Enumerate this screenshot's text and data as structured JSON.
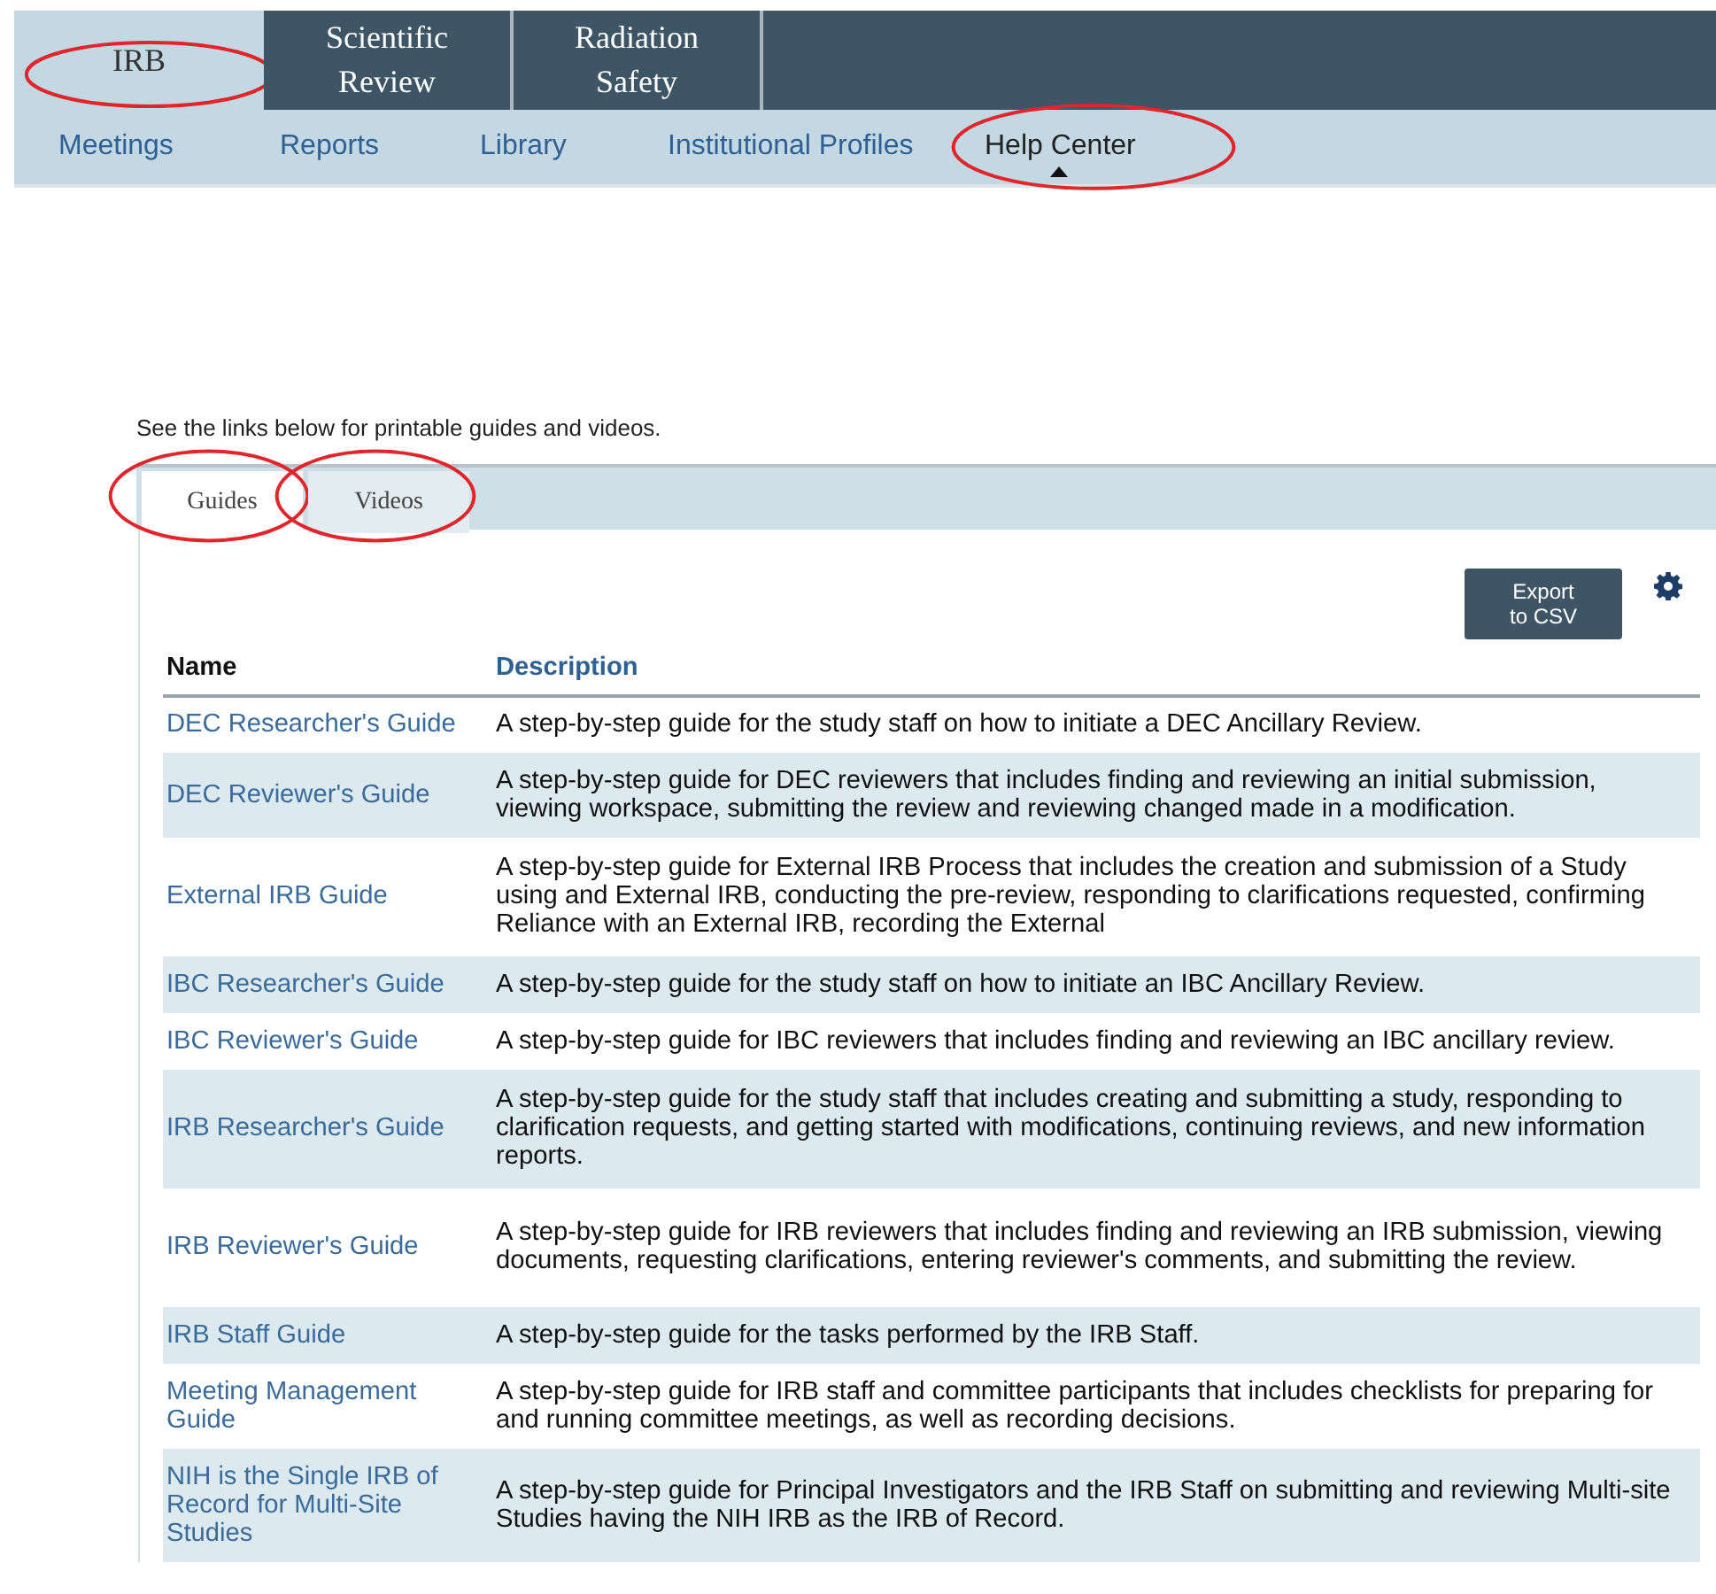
{
  "top_tabs": [
    {
      "label": "IRB",
      "selected": true,
      "circled": true
    },
    {
      "label": "Scientific Review",
      "selected": false,
      "circled": false
    },
    {
      "label": "Radiation Safety",
      "selected": false,
      "circled": false
    }
  ],
  "sub_nav": [
    {
      "label": "Meetings",
      "selected": false,
      "circled": false
    },
    {
      "label": "Reports",
      "selected": false,
      "circled": false
    },
    {
      "label": "Library",
      "selected": false,
      "circled": false
    },
    {
      "label": "Institutional Profiles",
      "selected": false,
      "circled": false
    },
    {
      "label": "Help Center",
      "selected": true,
      "circled": true
    }
  ],
  "intro": "See the links below for printable guides and videos.",
  "content_tabs": [
    {
      "label": "Guides",
      "selected": true,
      "circled": true
    },
    {
      "label": "Videos",
      "selected": false,
      "circled": true
    }
  ],
  "export_button": "Export to CSV",
  "table": {
    "columns": [
      "Name",
      "Description"
    ],
    "rows": [
      {
        "name": "DEC Researcher's Guide",
        "description": "A step-by-step guide for the study staff on how to initiate a DEC Ancillary Review."
      },
      {
        "name": "DEC Reviewer's Guide",
        "description": "A step-by-step guide for DEC reviewers that includes finding and reviewing an initial submission, viewing workspace, submitting the review and reviewing changed made in a modification."
      },
      {
        "name": "External IRB Guide",
        "description": "A step-by-step guide for External IRB Process that includes the creation and submission of a Study using and External IRB, conducting the pre-review, responding to clarifications requested, confirming Reliance with an External IRB, recording the External"
      },
      {
        "name": "IBC Researcher's Guide",
        "description": "A step-by-step guide for the study staff on how to initiate an IBC Ancillary Review."
      },
      {
        "name": "IBC Reviewer's Guide",
        "description": "A step-by-step guide for IBC reviewers that includes finding and reviewing an IBC ancillary review."
      },
      {
        "name": "IRB Researcher's Guide",
        "description": "A step-by-step guide for the study staff that includes creating and submitting a study, responding to clarification requests, and getting started with modifications, continuing reviews, and new information reports."
      },
      {
        "name": "IRB Reviewer's Guide",
        "description": "A step-by-step guide for IRB reviewers that includes finding and reviewing an IRB submission, viewing documents, requesting clarifications, entering reviewer's comments, and submitting the review."
      },
      {
        "name": "IRB Staff Guide",
        "description": "A step-by-step guide for the tasks performed by the IRB Staff."
      },
      {
        "name": "Meeting Management Guide",
        "description": "A step-by-step guide for IRB staff and committee participants that includes checklists for preparing for and running committee meetings, as well as recording decisions."
      },
      {
        "name": "NIH is the Single IRB of Record for Multi-Site Studies",
        "description": "A step-by-step guide for Principal Investigators and the IRB Staff on submitting and reviewing Multi-site Studies having the NIH IRB as the IRB of Record."
      }
    ]
  }
}
